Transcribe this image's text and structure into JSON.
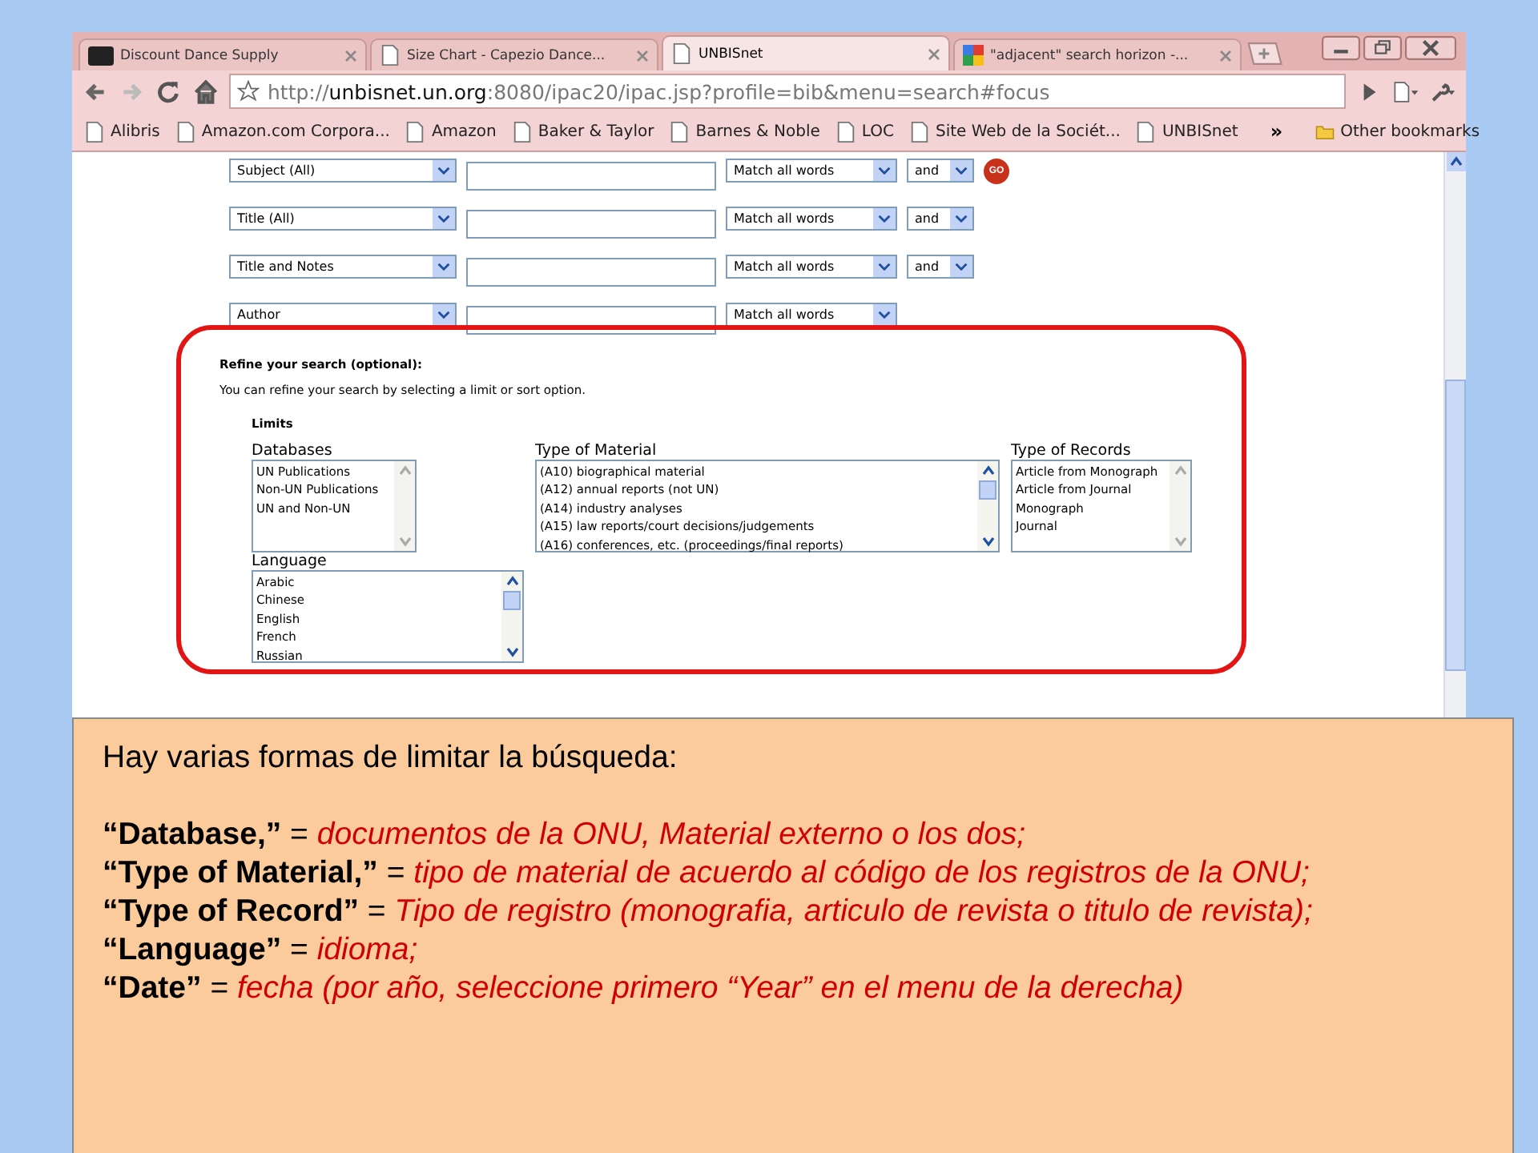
{
  "browser": {
    "tabs": [
      {
        "label": "Discount Dance Supply",
        "selected": false
      },
      {
        "label": "Size Chart - Capezio Dance...",
        "selected": false
      },
      {
        "label": "UNBISnet",
        "selected": true
      },
      {
        "label": "\"adjacent\" search horizon -...",
        "selected": false
      }
    ],
    "address": {
      "prefix": "http://",
      "host": "unbisnet.un.org",
      "rest": ":8080/ipac20/ipac.jsp?profile=bib&menu=search#focus"
    },
    "bookmarks": [
      "Alibris",
      "Amazon.com Corpora...",
      "Amazon",
      "Baker & Taylor",
      "Barnes & Noble",
      "LOC",
      "Site Web de la Sociét...",
      "UNBISnet"
    ],
    "bookmarks_more": "»",
    "other_bookmarks": "Other bookmarks"
  },
  "search_rows": [
    {
      "field": "Subject (All)",
      "match": "Match all words",
      "operator": "and",
      "go": "GO"
    },
    {
      "field": "Title (All)",
      "match": "Match all words",
      "operator": "and"
    },
    {
      "field": "Title and Notes",
      "match": "Match all words",
      "operator": "and"
    },
    {
      "field": "Author",
      "match": "Match all words"
    }
  ],
  "refine": {
    "title": "Refine your search (optional):",
    "description": "You can refine your search by selecting a limit or sort option.",
    "limits_label": "Limits",
    "lists": [
      {
        "label": "Databases",
        "kind": "plain",
        "options": [
          "UN Publications",
          "Non-UN Publications",
          "UN and Non-UN"
        ]
      },
      {
        "label": "Type of Material",
        "kind": "scroll",
        "options": [
          "(A10) biographical material",
          "(A12) annual reports (not UN)",
          "(A14) industry analyses",
          "(A15) law reports/court decisions/judgements",
          "(A16) conferences, etc. (proceedings/final reports)"
        ]
      },
      {
        "label": "Type of Records",
        "kind": "plain",
        "options": [
          "Article from Monograph",
          "Article from Journal",
          "Monograph",
          "Journal"
        ]
      },
      {
        "label": "Language",
        "kind": "scroll",
        "options": [
          "Arabic",
          "Chinese",
          "English",
          "French",
          "Russian"
        ]
      }
    ]
  },
  "note": {
    "intro": "Hay varias formas de limitar la búsqueda:",
    "items": [
      {
        "term": "“Database,”",
        "sep": "=",
        "definition": "documentos de la ONU, Material externo o los dos;"
      },
      {
        "term": "“Type of Material,”",
        "sep": "=",
        "definition": "tipo de material de acuerdo al código de los registros de la ONU;"
      },
      {
        "term": "“Type of Record”",
        "sep": "=",
        "definition": "Tipo de registro (monografia, articulo de revista o titulo de revista);"
      },
      {
        "term": "“Language”",
        "sep": "=",
        "definition": "idioma;"
      },
      {
        "term": "“Date”",
        "sep": "=",
        "definition": "fecha (por año, seleccione primero “Year” en el menu de la derecha)"
      }
    ]
  }
}
